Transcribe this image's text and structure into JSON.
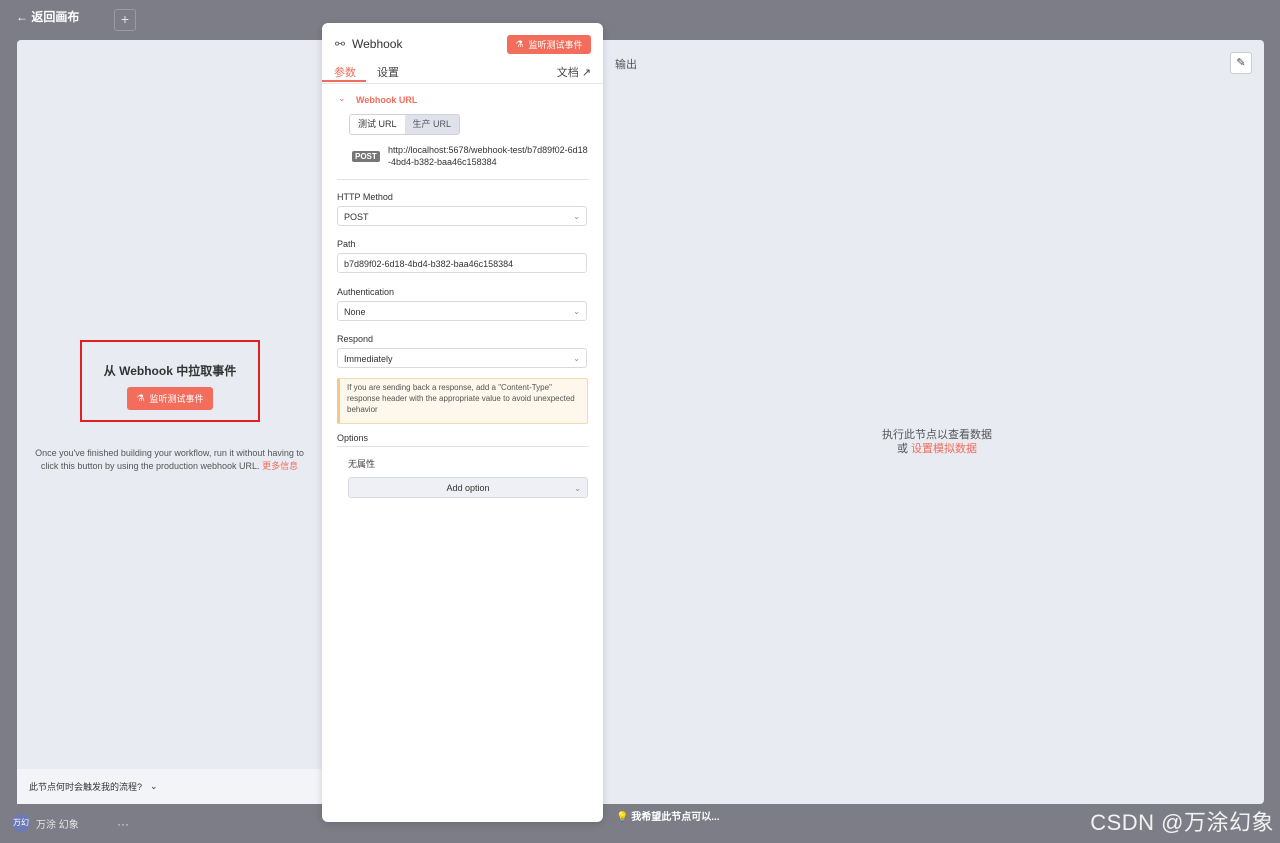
{
  "background": {
    "back_label": "← 返回画布",
    "plus_label": "+",
    "user_avatar": "万幻",
    "user_name": "万涂 幻象",
    "more_label": "···",
    "hint_label": "我希望此节点可以...",
    "watermark": "CSDN @万涂幻象"
  },
  "left": {
    "pull_title": "从 Webhook 中拉取事件",
    "listen_button": "监听测试事件",
    "desc": "Once you've finished building your workflow, run it without having to click this button by using the production webhook URL.",
    "more_info": "更多信息",
    "footer_question": "此节点何时会触发我的流程?"
  },
  "panel": {
    "title": "Webhook",
    "listen_button": "监听测试事件",
    "tabs": [
      "参数",
      "设置"
    ],
    "docs_label": "文档",
    "section_title": "Webhook URL",
    "url_toggle": [
      "测试 URL",
      "生产 URL"
    ],
    "method_badge": "POST",
    "webhook_url": "http://localhost:5678/webhook-test/b7d89f02-6d18-4bd4-b382-baa46c158384",
    "http_method_label": "HTTP Method",
    "http_method_value": "POST",
    "path_label": "Path",
    "path_value": "b7d89f02-6d18-4bd4-b382-baa46c158384",
    "auth_label": "Authentication",
    "auth_value": "None",
    "respond_label": "Respond",
    "respond_value": "Immediately",
    "notice": "If you are sending back a response, add a \"Content-Type\" response header with the appropriate value to avoid unexpected behavior",
    "options_label": "Options",
    "no_properties": "无属性",
    "add_option": "Add option"
  },
  "output": {
    "label": "输出",
    "exec_hint": "执行此节点以查看数据",
    "or_label": "或",
    "mock_link": "设置模拟数据"
  },
  "colors": {
    "accent": "#f26d5b",
    "overlay": "#7c7d86",
    "modal_bg": "#e8ebf2"
  }
}
